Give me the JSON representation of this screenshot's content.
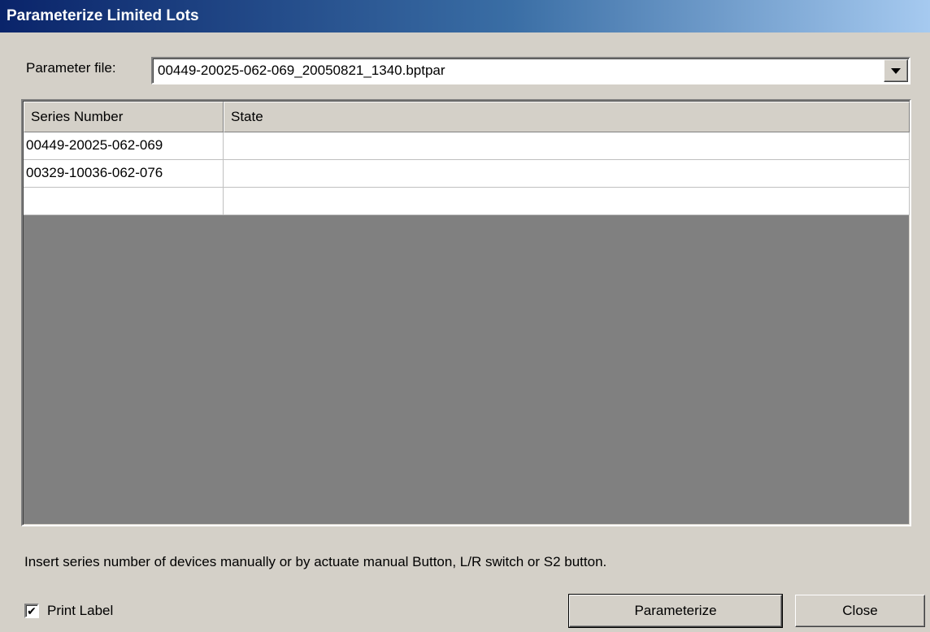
{
  "window": {
    "title": "Parameterize Limited Lots"
  },
  "parameter": {
    "label": "Parameter file:",
    "value": "00449-20025-062-069_20050821_1340.bptpar"
  },
  "grid": {
    "columns": [
      "Series Number",
      "State"
    ],
    "rows": [
      [
        "00449-20025-062-069",
        ""
      ],
      [
        "00329-10036-062-076",
        ""
      ],
      [
        "",
        ""
      ]
    ]
  },
  "hint": "Insert series number of devices manually or by actuate manual Button, L/R switch or S2 button.",
  "print_label": {
    "label": "Print Label",
    "checked": true,
    "mark": "✔"
  },
  "buttons": {
    "parameterize": "Parameterize",
    "close": "Close"
  }
}
